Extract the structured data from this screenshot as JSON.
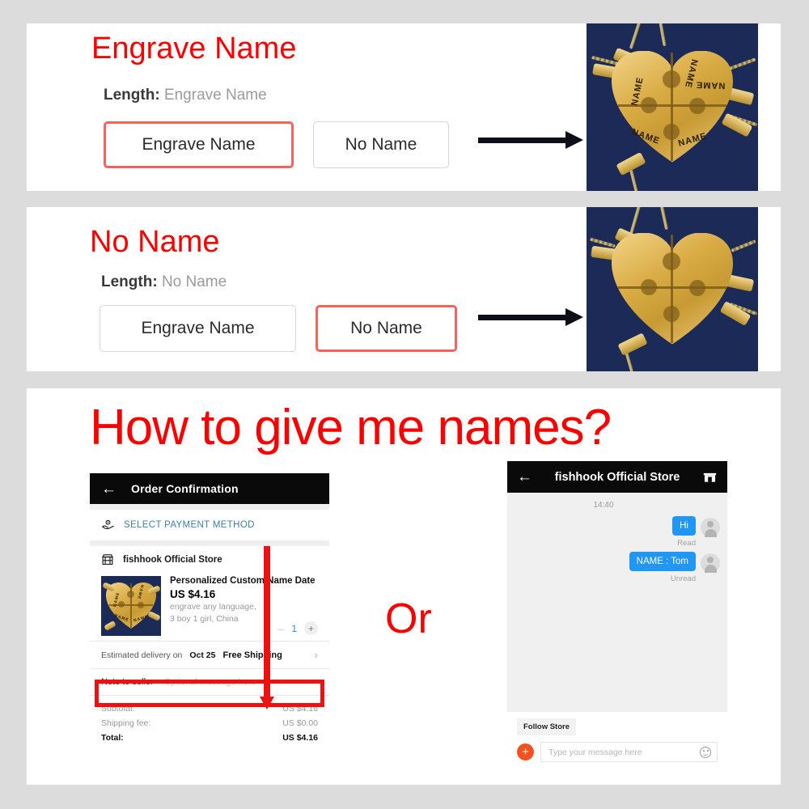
{
  "page": {
    "background_color": "#dcdcdc",
    "accent_red": "#fc0000",
    "highlight_red": "#ee1111",
    "selected_border": "#f4635c",
    "brand_blue": "#2196f3"
  },
  "option_panels": [
    {
      "title": "Engrave Name",
      "length_label": "Length:",
      "length_value": "Engrave Name",
      "buttons": [
        {
          "label": "Engrave Name",
          "selected": true
        },
        {
          "label": "No Name",
          "selected": false
        }
      ],
      "arrow": "right-arrow",
      "photo": {
        "alt": "gold puzzle heart necklace with engraved names",
        "background_color": "#1c2a57",
        "engraved": true,
        "engrave_text": "NAME",
        "piece_count": 4
      }
    },
    {
      "title": "No Name",
      "length_label": "Length:",
      "length_value": "No Name",
      "buttons": [
        {
          "label": "Engrave Name",
          "selected": false
        },
        {
          "label": "No Name",
          "selected": true
        }
      ],
      "arrow": "right-arrow",
      "photo": {
        "alt": "gold puzzle heart necklace blank no engraving",
        "background_color": "#1c2a57",
        "engraved": false,
        "engrave_text": "",
        "piece_count": 4
      }
    }
  ],
  "howto": {
    "title": "How to give me  names?",
    "or_label": "Or",
    "order_screenshot": {
      "header": {
        "back": "←",
        "title": "Order Confirmation"
      },
      "payment": {
        "icon": "hand-coin-icon",
        "label": "SELECT PAYMENT METHOD"
      },
      "store": {
        "icon": "storefront-icon",
        "name": "fishhook Official Store"
      },
      "item": {
        "name": "Personalized Custom Name Date ...",
        "price": "US $4.16",
        "variant_line1": "engrave any language,",
        "variant_line2": "3 boy 1 girl, China",
        "qty_minus": "–",
        "qty_value": "1",
        "qty_plus": "+"
      },
      "shipping": {
        "estimate_prefix": "Estimated delivery on",
        "estimate_date": "Oct 25",
        "free_shipping": "Free Shipping",
        "chevron": "›"
      },
      "note": {
        "label": "Note to seller",
        "placeholder": "Optional message here",
        "highlighted": true
      },
      "totals": [
        {
          "label": "Subtotal:",
          "value": "US $4.16",
          "grand": false
        },
        {
          "label": "Shipping fee:",
          "value": "US $0.00",
          "grand": false
        },
        {
          "label": "Total:",
          "value": "US $4.16",
          "grand": true
        }
      ]
    },
    "chat_screenshot": {
      "header": {
        "back": "←",
        "title": "fishhook Official Store",
        "store_icon": "storefront-icon"
      },
      "timestamp": "14:40",
      "messages": [
        {
          "text": "Hi",
          "status": "Read",
          "outgoing": true
        },
        {
          "text": "NAME : Tom",
          "status": "Unread",
          "outgoing": true
        }
      ],
      "follow_store_label": "Follow Store",
      "composer": {
        "plus": "+",
        "placeholder": "Type your message here",
        "emoji_icon": "smiley-icon"
      }
    }
  }
}
